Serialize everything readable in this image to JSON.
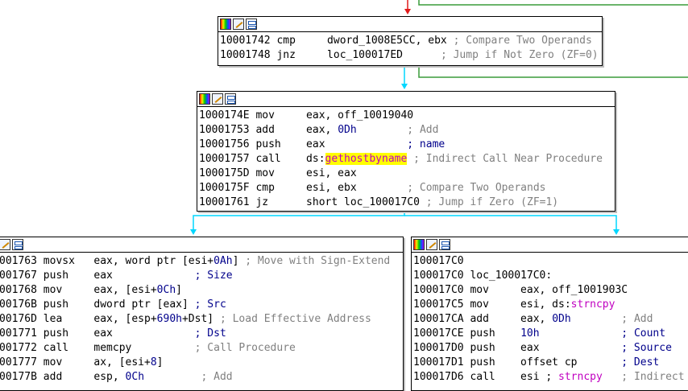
{
  "theme": {
    "cyan_edge": "#00d7ff",
    "green_edge": "#3a9c3a",
    "red_edge": "#e11b1b"
  },
  "block1": {
    "lines": [
      [
        {
          "t": "10001742 cmp     dword_1008E5CC, ebx "
        },
        {
          "t": "; Compare Two Operands",
          "c": "c"
        }
      ],
      [
        {
          "t": "10001748 jnz     loc_100017ED      "
        },
        {
          "t": "; Jump if Not Zero (ZF=0)",
          "c": "c"
        }
      ]
    ]
  },
  "block2": {
    "lines": [
      [
        {
          "t": "1000174E mov     eax, off_10019040"
        }
      ],
      [
        {
          "t": "10001753 add     eax, "
        },
        {
          "t": "0Dh",
          "c": "n"
        },
        {
          "t": "        "
        },
        {
          "t": "; Add",
          "c": "c"
        }
      ],
      [
        {
          "t": "10001756 push    eax             "
        },
        {
          "t": "; name",
          "c": "n"
        }
      ],
      [
        {
          "t": "10001757 call    ds:"
        },
        {
          "t": "gethostbyname",
          "c": "hl"
        },
        {
          "t": " "
        },
        {
          "t": "; Indirect Call Near Procedure",
          "c": "c"
        }
      ],
      [
        {
          "t": "1000175D mov     esi, eax"
        }
      ],
      [
        {
          "t": "1000175F cmp     esi, ebx        "
        },
        {
          "t": "; Compare Two Operands",
          "c": "c"
        }
      ],
      [
        {
          "t": "10001761 jz      short loc_100017C0 "
        },
        {
          "t": "; Jump if Zero (ZF=1)",
          "c": "c"
        }
      ]
    ]
  },
  "block3": {
    "lines": [
      [
        {
          "t": "001763 movsx   eax, word ptr [esi+"
        },
        {
          "t": "0Ah",
          "c": "n"
        },
        {
          "t": "] "
        },
        {
          "t": "; Move with Sign-Extend",
          "c": "c"
        }
      ],
      [
        {
          "t": "001767 push    eax             "
        },
        {
          "t": "; Size",
          "c": "n"
        }
      ],
      [
        {
          "t": "001768 mov     eax, [esi+"
        },
        {
          "t": "0Ch",
          "c": "n"
        },
        {
          "t": "]"
        }
      ],
      [
        {
          "t": "00176B push    dword ptr [eax] "
        },
        {
          "t": "; Src",
          "c": "n"
        }
      ],
      [
        {
          "t": "00176D lea     eax, [esp+"
        },
        {
          "t": "690h",
          "c": "n"
        },
        {
          "t": "+Dst] "
        },
        {
          "t": "; Load Effective Address",
          "c": "c"
        }
      ],
      [
        {
          "t": "001771 push    eax             "
        },
        {
          "t": "; Dst",
          "c": "n"
        }
      ],
      [
        {
          "t": "001772 call    memcpy          "
        },
        {
          "t": "; Call Procedure",
          "c": "c"
        }
      ],
      [
        {
          "t": "001777 mov     ax, [esi+"
        },
        {
          "t": "8",
          "c": "n"
        },
        {
          "t": "]"
        }
      ],
      [
        {
          "t": "00177B add     esp, "
        },
        {
          "t": "0Ch",
          "c": "n"
        },
        {
          "t": "         "
        },
        {
          "t": "; Add",
          "c": "c"
        }
      ]
    ]
  },
  "block4": {
    "lines": [
      [
        {
          "t": "100017C0"
        }
      ],
      [
        {
          "t": "100017C0 loc_100017C0:"
        }
      ],
      [
        {
          "t": "100017C0 mov     eax, off_1001903C"
        }
      ],
      [
        {
          "t": "100017C5 mov     esi, ds:"
        },
        {
          "t": "strncpy",
          "c": "mag"
        }
      ],
      [
        {
          "t": "100017CA add     eax, "
        },
        {
          "t": "0Dh",
          "c": "n"
        },
        {
          "t": "        "
        },
        {
          "t": "; Add",
          "c": "c"
        }
      ],
      [
        {
          "t": "100017CE push    "
        },
        {
          "t": "10h",
          "c": "n"
        },
        {
          "t": "             "
        },
        {
          "t": "; Count",
          "c": "n"
        }
      ],
      [
        {
          "t": "100017D0 push    eax             "
        },
        {
          "t": "; Source",
          "c": "n"
        }
      ],
      [
        {
          "t": "100017D1 push    offset cp       "
        },
        {
          "t": "; Dest",
          "c": "n"
        }
      ],
      [
        {
          "t": "100017D6 call    esi ; "
        },
        {
          "t": "strncpy",
          "c": "mag"
        },
        {
          "t": "   "
        },
        {
          "t": "; Indirect",
          "c": "c"
        }
      ]
    ]
  }
}
